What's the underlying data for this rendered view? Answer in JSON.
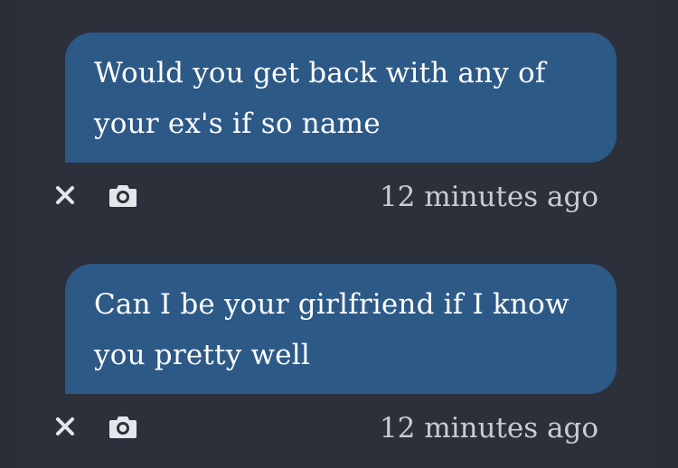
{
  "messages": [
    {
      "text": "Would you get back with any of your ex's if so name",
      "timestamp": "12 minutes ago"
    },
    {
      "text": "Can I be your girlfriend if I know you pretty well",
      "timestamp": "12 minutes ago"
    }
  ],
  "icons": {
    "close": "close-icon",
    "camera": "camera-icon"
  },
  "colors": {
    "background": "#2b2e38",
    "panel": "#2c303b",
    "bubble": "#2d5987",
    "message_text": "#ffffff",
    "timestamp_text": "#c8ccd5",
    "icon": "#e4e6ea"
  }
}
